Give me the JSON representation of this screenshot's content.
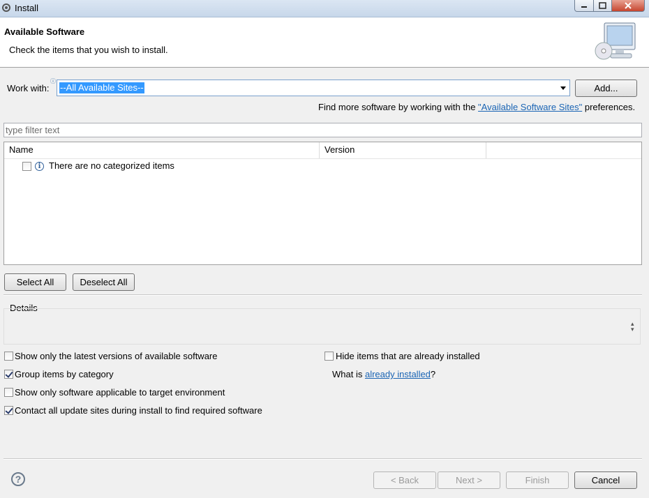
{
  "window": {
    "title": "Install"
  },
  "header": {
    "title": "Available Software",
    "description": "Check the items that you wish to install."
  },
  "work_with": {
    "label": "Work with:",
    "value": "--All Available Sites--",
    "add_label": "Add..."
  },
  "find_more": {
    "prefix": "Find more software by working with the ",
    "link": "\"Available Software Sites\"",
    "suffix": " preferences."
  },
  "filter": {
    "placeholder": "type filter text"
  },
  "table": {
    "columns": [
      "Name",
      "Version"
    ],
    "rows": [
      {
        "name": "There are no categorized items",
        "checked": false
      }
    ]
  },
  "buttons": {
    "select_all": "Select All",
    "deselect_all": "Deselect All"
  },
  "details": {
    "label": "Details"
  },
  "options": [
    {
      "label": "Show only the latest versions of available software",
      "checked": false
    },
    {
      "label": "Group items by category",
      "checked": true
    },
    {
      "label": "Show only software applicable to target environment",
      "checked": false
    },
    {
      "label": "Contact all update sites during install to find required software",
      "checked": true
    }
  ],
  "hide_installed": {
    "label": "Hide items that are already installed",
    "checked": false
  },
  "what_is": {
    "prefix": "What is ",
    "link": "already installed",
    "suffix": "?"
  },
  "footer": {
    "back": "< Back",
    "next": "Next >",
    "finish": "Finish",
    "cancel": "Cancel"
  }
}
